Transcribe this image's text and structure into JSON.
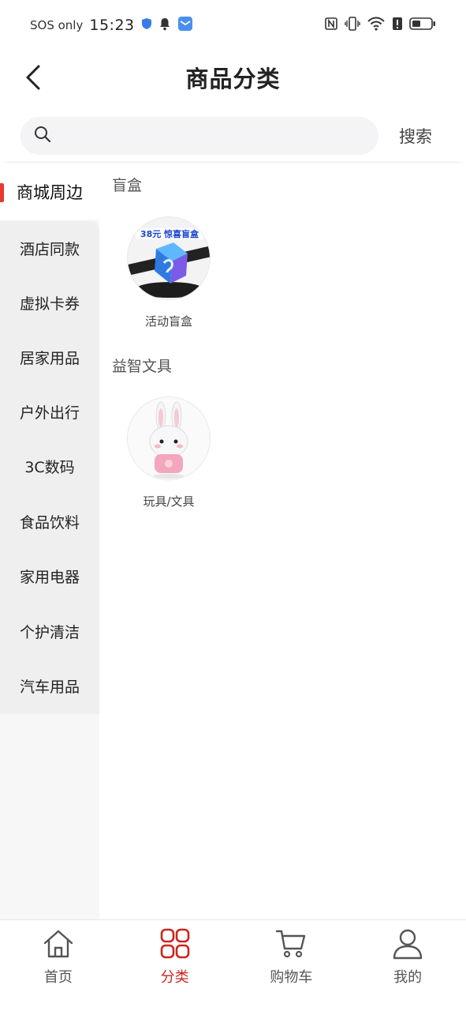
{
  "status_bar": {
    "carrier": "SOS only",
    "time": "15:23",
    "left_icons": [
      "shield-icon",
      "bell-icon",
      "mail-icon"
    ],
    "right_icons": [
      "nfc-icon",
      "vibrate-icon",
      "wifi-icon",
      "alert-icon",
      "battery-icon"
    ]
  },
  "header": {
    "title": "商品分类",
    "back_icon": "chevron-left-icon"
  },
  "search": {
    "placeholder": "",
    "value": "",
    "button_label": "搜索"
  },
  "sidebar": {
    "active_index": 0,
    "items": [
      {
        "label": "商城周边"
      },
      {
        "label": "酒店同款"
      },
      {
        "label": "虚拟卡券"
      },
      {
        "label": "居家用品"
      },
      {
        "label": "户外出行"
      },
      {
        "label": "3C数码"
      },
      {
        "label": "食品饮料"
      },
      {
        "label": "家用电器"
      },
      {
        "label": "个护清洁"
      },
      {
        "label": "汽车用品"
      }
    ]
  },
  "content": {
    "sections": [
      {
        "title": "盲盒",
        "products": [
          {
            "label": "活动盲盒",
            "image_text": "38元 惊喜盲盒"
          }
        ]
      },
      {
        "title": "益智文具",
        "products": [
          {
            "label": "玩具/文具"
          }
        ]
      }
    ]
  },
  "tabbar": {
    "active_index": 1,
    "accent_color": "#c8271f",
    "items": [
      {
        "label": "首页",
        "icon": "home-icon"
      },
      {
        "label": "分类",
        "icon": "grid-icon"
      },
      {
        "label": "购物车",
        "icon": "cart-icon"
      },
      {
        "label": "我的",
        "icon": "user-icon"
      }
    ]
  }
}
